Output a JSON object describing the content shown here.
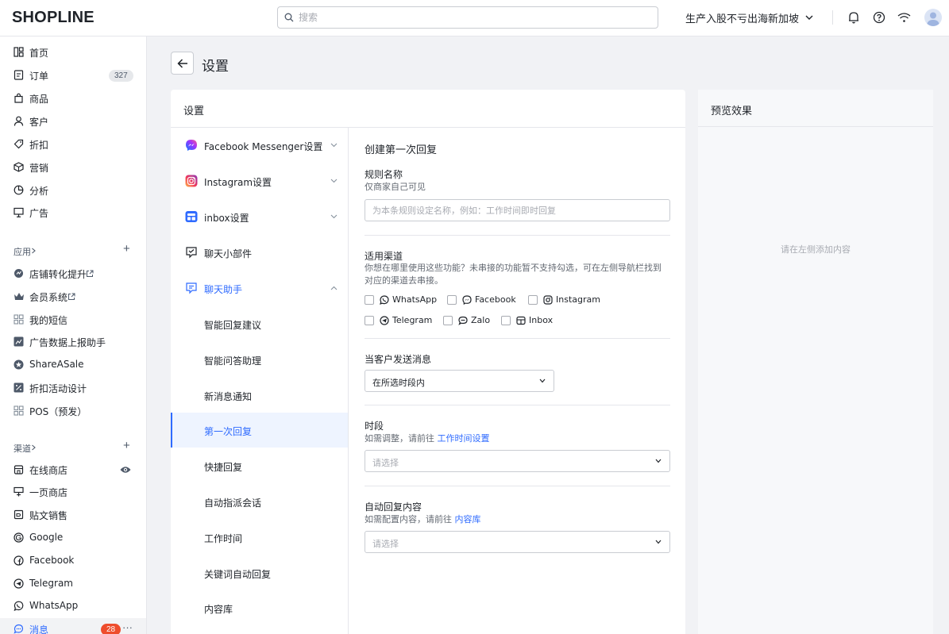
{
  "topbar": {
    "logo": "SHOPLINE",
    "search_placeholder": "搜索",
    "store_name": "生产入股不亏出海新加坡"
  },
  "sidebar": {
    "main_items": [
      {
        "label": "首页",
        "icon": "home-icon"
      },
      {
        "label": "订单",
        "icon": "order-icon",
        "badge": "327"
      },
      {
        "label": "商品",
        "icon": "product-icon"
      },
      {
        "label": "客户",
        "icon": "customer-icon"
      },
      {
        "label": "折扣",
        "icon": "discount-icon"
      },
      {
        "label": "营销",
        "icon": "marketing-icon"
      },
      {
        "label": "分析",
        "icon": "analytics-icon"
      },
      {
        "label": "广告",
        "icon": "ads-icon"
      }
    ],
    "apps_section": "应用",
    "app_items": [
      {
        "label": "店铺转化提升",
        "icon": "conversion-icon"
      },
      {
        "label": "会员系统",
        "icon": "crown-icon"
      },
      {
        "label": "我的短信",
        "icon": "grid-icon"
      },
      {
        "label": "广告数据上报助手",
        "icon": "chart-icon"
      },
      {
        "label": "ShareASale",
        "icon": "star-icon"
      },
      {
        "label": "折扣活动设计",
        "icon": "percent-icon"
      },
      {
        "label": "POS（预发）",
        "icon": "grid-icon"
      }
    ],
    "channels_section": "渠道",
    "channel_items": [
      {
        "label": "在线商店",
        "icon": "store-icon"
      },
      {
        "label": "一页商店",
        "icon": "onepage-icon"
      },
      {
        "label": "贴文销售",
        "icon": "post-icon"
      },
      {
        "label": "Google",
        "icon": "google-icon"
      },
      {
        "label": "Facebook",
        "icon": "facebook-icon"
      },
      {
        "label": "Telegram",
        "icon": "telegram-icon"
      },
      {
        "label": "WhatsApp",
        "icon": "whatsapp-icon"
      },
      {
        "label": "消息",
        "icon": "message-icon",
        "badge": "28"
      }
    ]
  },
  "page": {
    "title": "设置"
  },
  "settings_card": {
    "title": "设置",
    "menu": [
      {
        "label": "Facebook Messenger设置"
      },
      {
        "label": "Instagram设置"
      },
      {
        "label": "inbox设置"
      },
      {
        "label": "聊天小部件"
      },
      {
        "label": "聊天助手"
      }
    ],
    "sub_menu": [
      {
        "label": "智能回复建议"
      },
      {
        "label": "智能问答助理"
      },
      {
        "label": "新消息通知"
      },
      {
        "label": "第一次回复"
      },
      {
        "label": "快捷回复"
      },
      {
        "label": "自动指派会话"
      },
      {
        "label": "工作时间"
      },
      {
        "label": "关键词自动回复"
      },
      {
        "label": "内容库"
      }
    ]
  },
  "form": {
    "title": "创建第一次回复",
    "rule_name": {
      "label": "规则名称",
      "help": "仅商家自己可见",
      "placeholder": "为本条规则设定名称，例如：工作时间即时回复"
    },
    "channels": {
      "label": "适用渠道",
      "help_line1": "你想在哪里使用这些功能？未串接的功能暂不支持勾选，可在左侧导航栏找到",
      "help_line2": "对应的渠道去串接。",
      "options": [
        {
          "label": "WhatsApp",
          "icon": "whatsapp-icon"
        },
        {
          "label": "Facebook",
          "icon": "messenger-icon"
        },
        {
          "label": "Instagram",
          "icon": "instagram-icon"
        },
        {
          "label": "Telegram",
          "icon": "telegram-icon"
        },
        {
          "label": "Zalo",
          "icon": "zalo-icon"
        },
        {
          "label": "Inbox",
          "icon": "inbox-icon"
        }
      ]
    },
    "trigger": {
      "label": "当客户发送消息",
      "value": "在所选时段内"
    },
    "period": {
      "label": "时段",
      "help_prefix": "如需调整，请前往 ",
      "help_link": "工作时间设置",
      "placeholder": "请选择"
    },
    "content": {
      "label": "自动回复内容",
      "help_prefix": "如需配置内容，请前往 ",
      "help_link": "内容库",
      "placeholder": "请选择"
    }
  },
  "preview": {
    "title": "预览效果",
    "empty_text": "请在左侧添加内容"
  },
  "colors": {
    "accent": "#2f6bff",
    "badge_red": "#ee4d2d"
  }
}
